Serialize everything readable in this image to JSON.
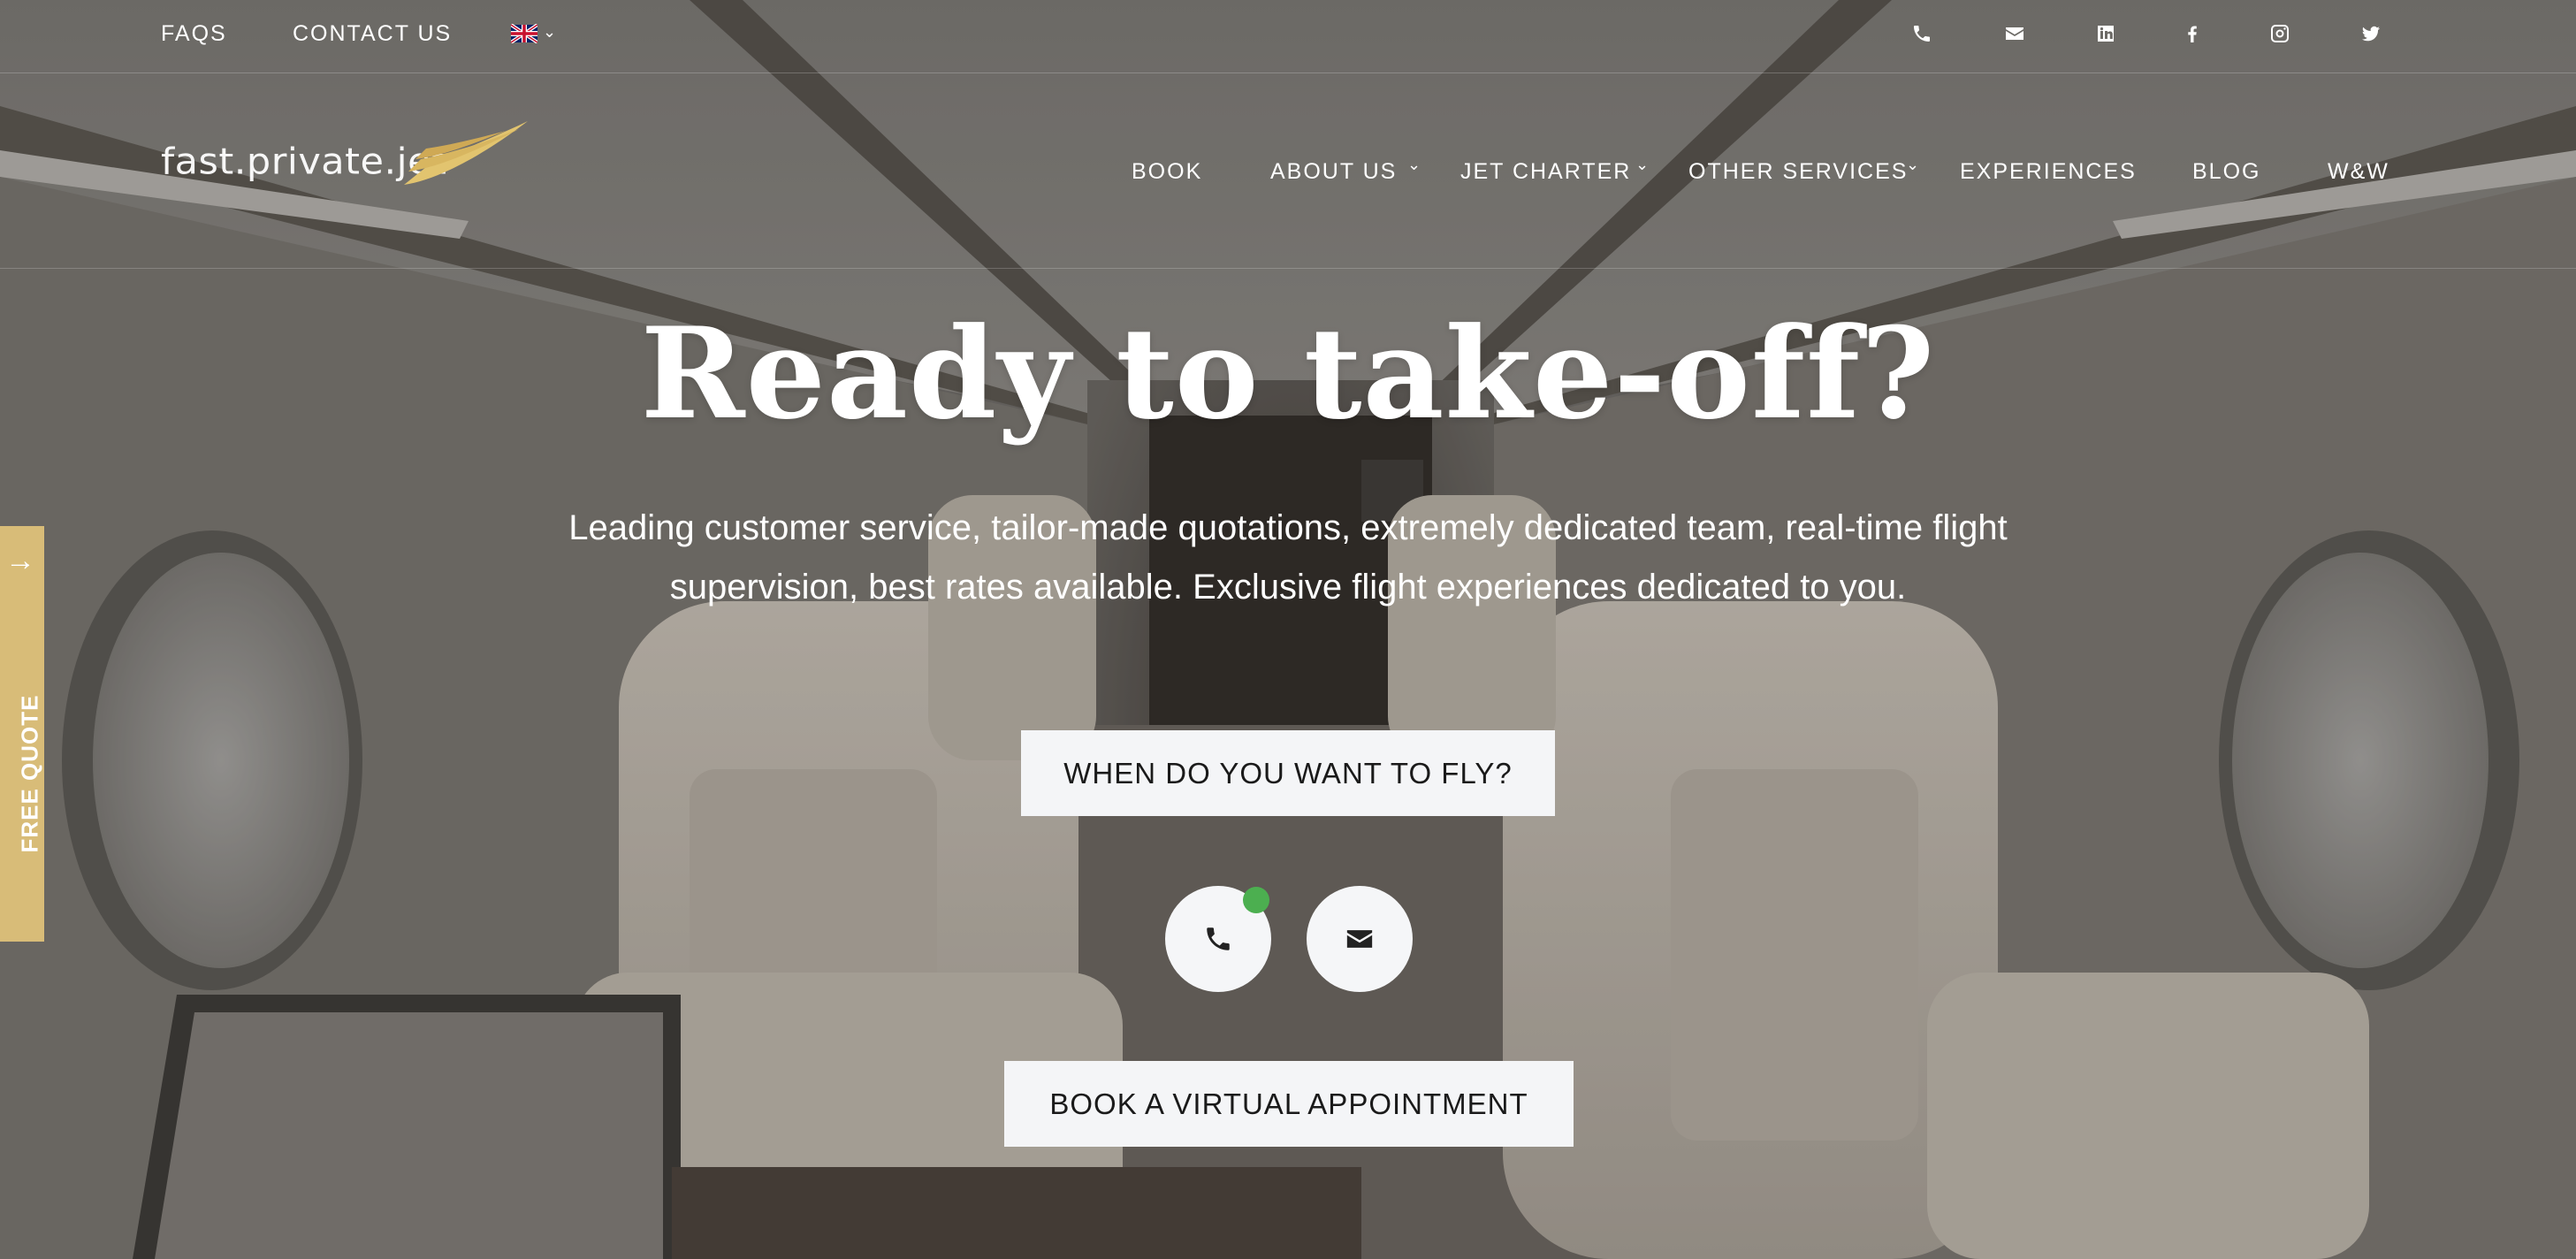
{
  "topbar": {
    "faqs": "FAQS",
    "contact": "CONTACT US",
    "language_icon": "uk-flag-icon",
    "social_icons": [
      "phone-icon",
      "envelope-icon",
      "linkedin-icon",
      "facebook-icon",
      "instagram-icon",
      "twitter-icon"
    ]
  },
  "logo": {
    "text": "fast.private.jet"
  },
  "nav": {
    "items": [
      "BOOK",
      "ABOUT US",
      "JET CHARTER",
      "OTHER SERVICES",
      "EXPERIENCES",
      "BLOG",
      "W&W"
    ]
  },
  "hero": {
    "title": "Ready to take-off?",
    "subtitle": "Leading customer service, tailor-made quotations, extremely dedicated team, real-time flight supervision, best rates available. Exclusive flight experiences dedicated to you.",
    "cta_fly": "WHEN DO YOU WANT TO FLY?",
    "cta_virtual": "BOOK A VIRTUAL APPOINTMENT"
  },
  "side_tab": {
    "label": "FREE QUOTE"
  },
  "colors": {
    "accent_gold": "#d8bc78",
    "online_green": "#4caf50",
    "button_bg": "#f4f5f7"
  }
}
